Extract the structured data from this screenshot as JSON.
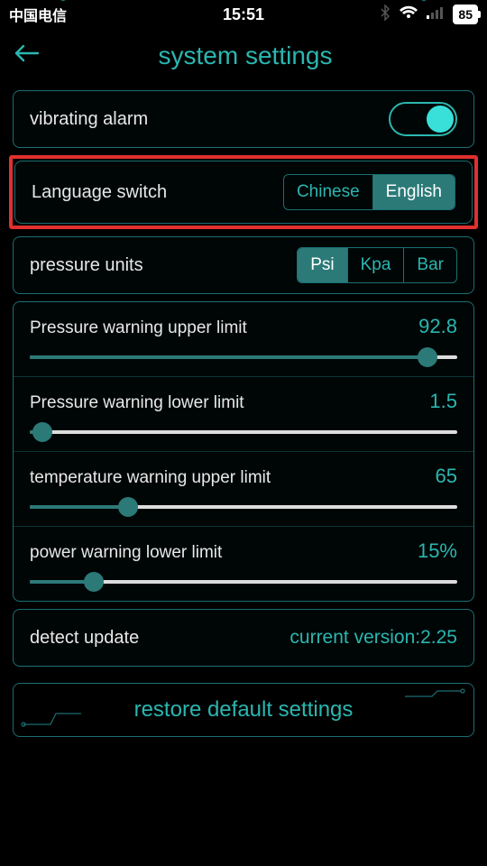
{
  "status": {
    "carrier": "中国电信",
    "time": "15:51",
    "battery": "85"
  },
  "header": {
    "title": "system settings"
  },
  "vibrating": {
    "label": "vibrating alarm",
    "on": true
  },
  "language": {
    "label": "Language switch",
    "options": [
      "Chinese",
      "English"
    ],
    "selected": "English"
  },
  "pressure_units": {
    "label": "pressure units",
    "options": [
      "Psi",
      "Kpa",
      "Bar"
    ],
    "selected": "Psi"
  },
  "sliders": {
    "pressure_upper": {
      "label": "Pressure warning upper limit",
      "value": "92.8",
      "pct": 93
    },
    "pressure_lower": {
      "label": "Pressure warning lower limit",
      "value": "1.5",
      "pct": 3
    },
    "temp_upper": {
      "label": "temperature warning upper limit",
      "value": "65",
      "pct": 23
    },
    "power_lower": {
      "label": "power warning lower limit",
      "value": "15%",
      "pct": 15
    }
  },
  "update": {
    "label": "detect update",
    "value": "current version:2.25"
  },
  "restore": {
    "label": "restore default settings"
  }
}
